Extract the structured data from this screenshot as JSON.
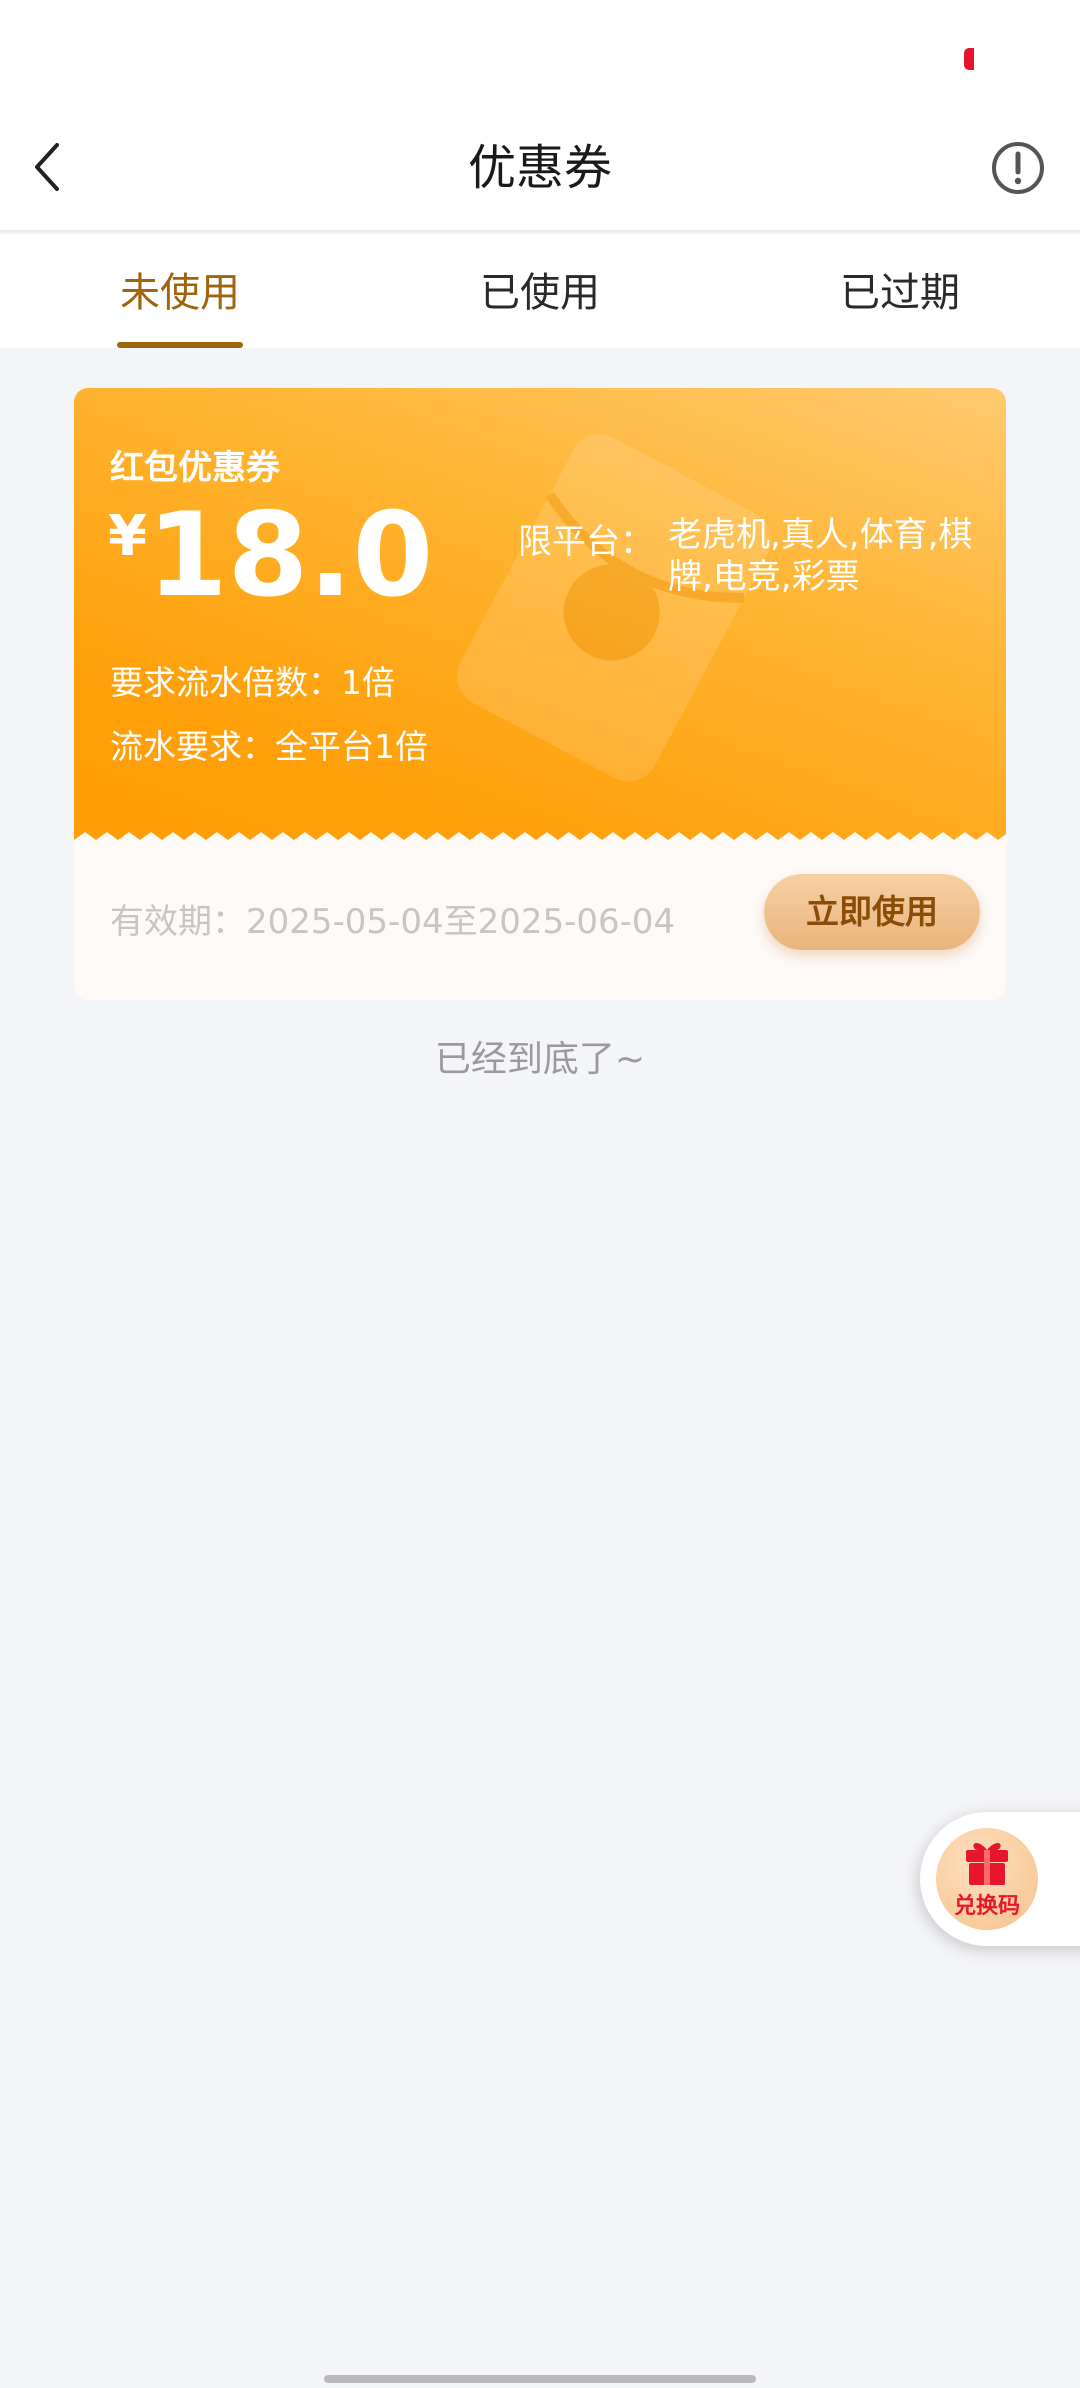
{
  "nav": {
    "title": "优惠券"
  },
  "tabs": [
    {
      "label": "未使用",
      "active": true
    },
    {
      "label": "已使用",
      "active": false
    },
    {
      "label": "已过期",
      "active": false
    }
  ],
  "coupon": {
    "type": "红包优惠券",
    "currency": "¥",
    "amount": "18.0",
    "platform_label": "限平台：",
    "platform_value": "老虎机,真人,体育,棋牌,电竞,彩票",
    "multiplier": "要求流水倍数：1倍",
    "turnover": "流水要求：全平台1倍",
    "validity": "有效期：2025-05-04至2025-06-04",
    "use_button": "立即使用"
  },
  "list_end": "已经到底了~",
  "redeem": {
    "label": "兑换码"
  },
  "colors": {
    "accent": "#a0650c",
    "coupon_orange": "#ffa10c",
    "badge_red": "#e8162c"
  }
}
